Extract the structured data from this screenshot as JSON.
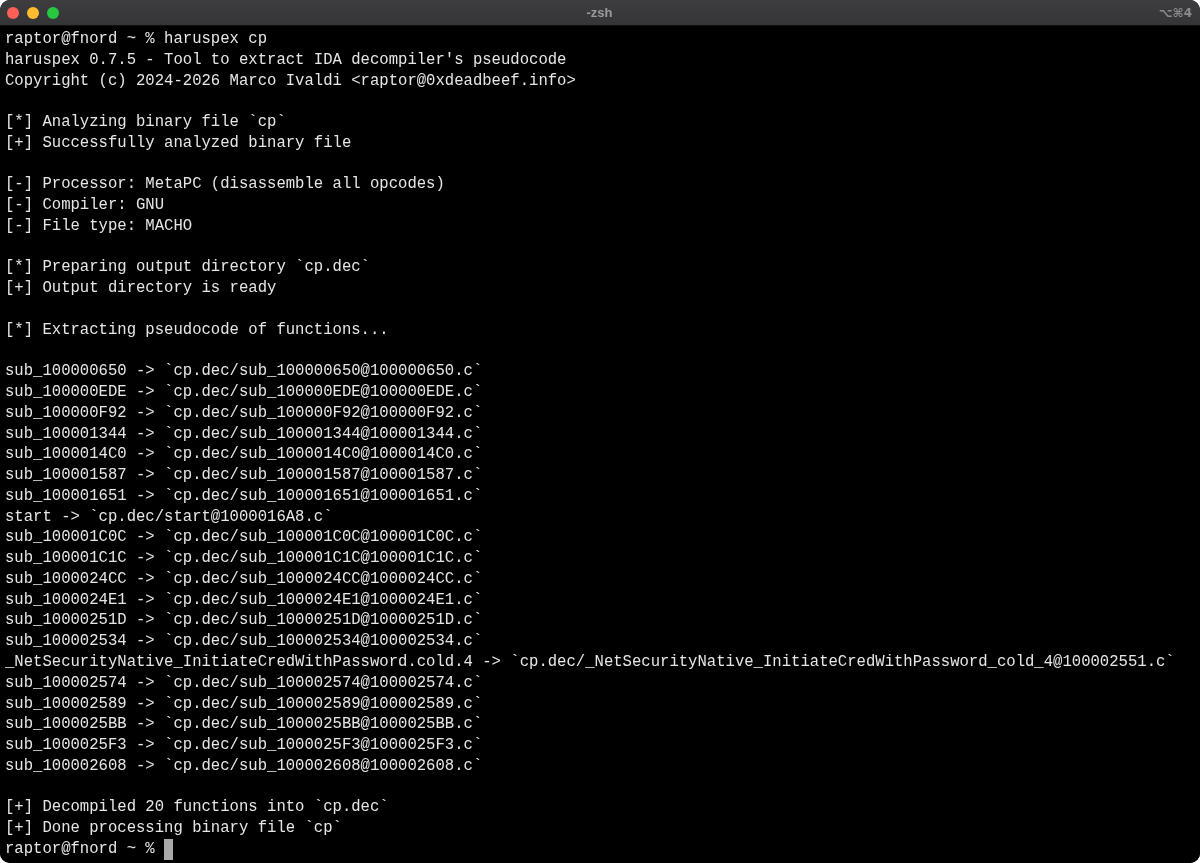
{
  "window": {
    "title": "-zsh",
    "shortcut": "⌥⌘4"
  },
  "terminal": {
    "groups": [
      {
        "lines": [
          {
            "kind": "prompt",
            "prompt": "raptor@fnord ~ %",
            "command": "haruspex cp",
            "cursor": false
          },
          {
            "kind": "output",
            "text": "haruspex 0.7.5 - Tool to extract IDA decompiler's pseudocode"
          },
          {
            "kind": "output",
            "text": "Copyright (c) 2024-2026 Marco Ivaldi <raptor@0xdeadbeef.info>"
          }
        ]
      },
      {
        "lines": [
          {
            "kind": "output",
            "text": "[*] Analyzing binary file `cp`"
          },
          {
            "kind": "output",
            "text": "[+] Successfully analyzed binary file"
          }
        ]
      },
      {
        "lines": [
          {
            "kind": "output",
            "text": "[-] Processor: MetaPC (disassemble all opcodes)"
          },
          {
            "kind": "output",
            "text": "[-] Compiler: GNU"
          },
          {
            "kind": "output",
            "text": "[-] File type: MACHO"
          }
        ]
      },
      {
        "lines": [
          {
            "kind": "output",
            "text": "[*] Preparing output directory `cp.dec`"
          },
          {
            "kind": "output",
            "text": "[+] Output directory is ready"
          }
        ]
      },
      {
        "lines": [
          {
            "kind": "output",
            "text": "[*] Extracting pseudocode of functions..."
          }
        ]
      },
      {
        "lines": [
          {
            "kind": "output",
            "text": "sub_100000650 -> `cp.dec/sub_100000650@100000650.c`"
          },
          {
            "kind": "output",
            "text": "sub_100000EDE -> `cp.dec/sub_100000EDE@100000EDE.c`"
          },
          {
            "kind": "output",
            "text": "sub_100000F92 -> `cp.dec/sub_100000F92@100000F92.c`"
          },
          {
            "kind": "output",
            "text": "sub_100001344 -> `cp.dec/sub_100001344@100001344.c`"
          },
          {
            "kind": "output",
            "text": "sub_1000014C0 -> `cp.dec/sub_1000014C0@1000014C0.c`"
          },
          {
            "kind": "output",
            "text": "sub_100001587 -> `cp.dec/sub_100001587@100001587.c`"
          },
          {
            "kind": "output",
            "text": "sub_100001651 -> `cp.dec/sub_100001651@100001651.c`"
          },
          {
            "kind": "output",
            "text": "start -> `cp.dec/start@1000016A8.c`"
          },
          {
            "kind": "output",
            "text": "sub_100001C0C -> `cp.dec/sub_100001C0C@100001C0C.c`"
          },
          {
            "kind": "output",
            "text": "sub_100001C1C -> `cp.dec/sub_100001C1C@100001C1C.c`"
          },
          {
            "kind": "output",
            "text": "sub_1000024CC -> `cp.dec/sub_1000024CC@1000024CC.c`"
          },
          {
            "kind": "output",
            "text": "sub_1000024E1 -> `cp.dec/sub_1000024E1@1000024E1.c`"
          },
          {
            "kind": "output",
            "text": "sub_10000251D -> `cp.dec/sub_10000251D@10000251D.c`"
          },
          {
            "kind": "output",
            "text": "sub_100002534 -> `cp.dec/sub_100002534@100002534.c`"
          },
          {
            "kind": "output",
            "text": "_NetSecurityNative_InitiateCredWithPassword.cold.4 -> `cp.dec/_NetSecurityNative_InitiateCredWithPassword_cold_4@100002551.c`"
          },
          {
            "kind": "output",
            "text": "sub_100002574 -> `cp.dec/sub_100002574@100002574.c`"
          },
          {
            "kind": "output",
            "text": "sub_100002589 -> `cp.dec/sub_100002589@100002589.c`"
          },
          {
            "kind": "output",
            "text": "sub_1000025BB -> `cp.dec/sub_1000025BB@1000025BB.c`"
          },
          {
            "kind": "output",
            "text": "sub_1000025F3 -> `cp.dec/sub_1000025F3@1000025F3.c`"
          },
          {
            "kind": "output",
            "text": "sub_100002608 -> `cp.dec/sub_100002608@100002608.c`"
          }
        ]
      },
      {
        "lines": [
          {
            "kind": "output",
            "text": "[+] Decompiled 20 functions into `cp.dec`"
          },
          {
            "kind": "output",
            "text": "[+] Done processing binary file `cp`"
          },
          {
            "kind": "prompt",
            "prompt": "raptor@fnord ~ %",
            "cursor": true
          }
        ]
      }
    ]
  }
}
